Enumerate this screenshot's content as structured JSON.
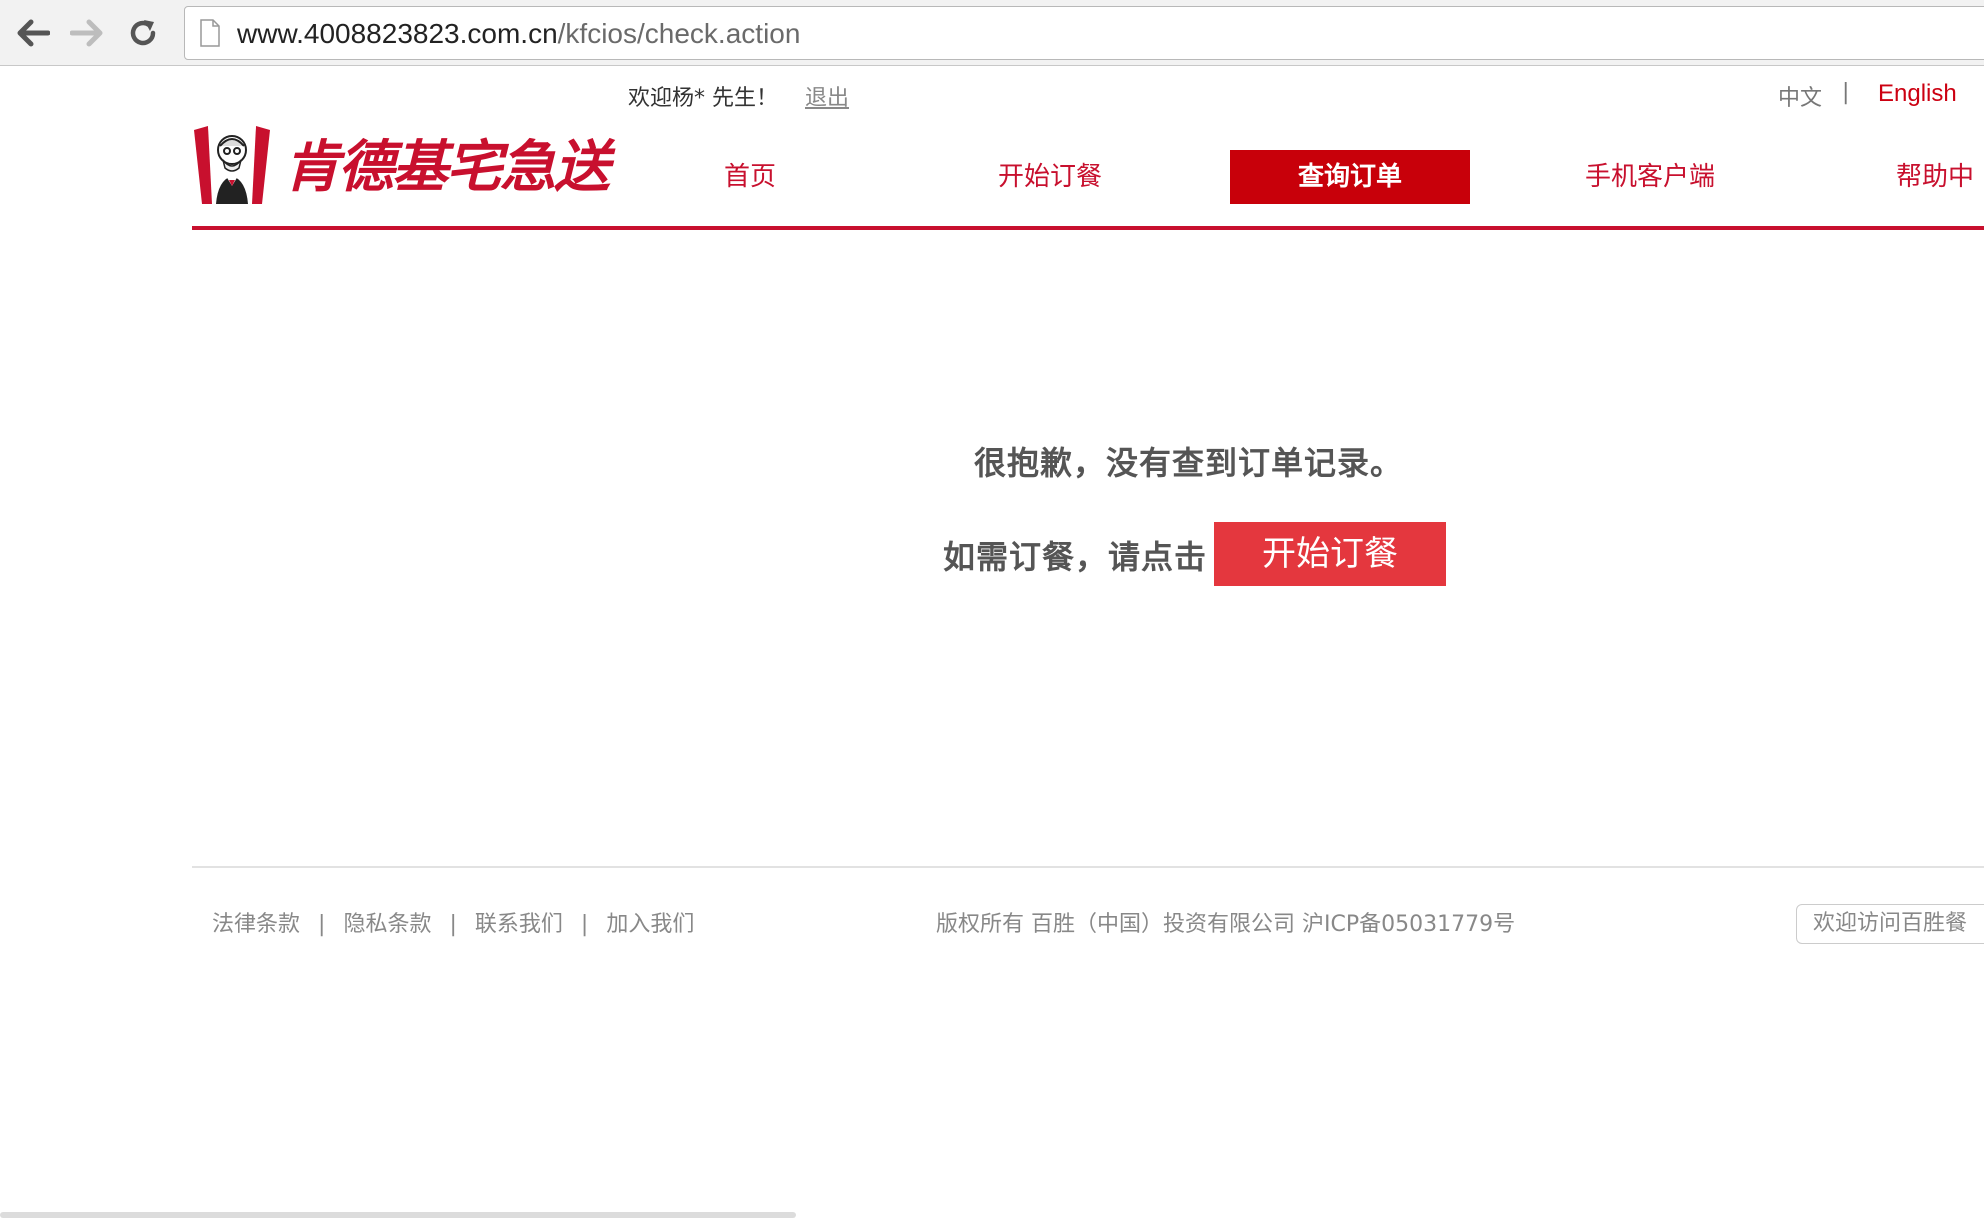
{
  "browser": {
    "url_host": "www.4008823823.com.cn",
    "url_path": "/kfcios/check.action"
  },
  "topbar": {
    "welcome": "欢迎杨* 先生！",
    "logout": "退出",
    "lang_zh": "中文",
    "lang_sep": "|",
    "lang_en": "English"
  },
  "logo": {
    "text": "肯德基宅急送"
  },
  "nav": {
    "items": [
      {
        "label": "首页"
      },
      {
        "label": "开始订餐"
      },
      {
        "label": "查询订单",
        "active": true
      },
      {
        "label": "手机客户端"
      },
      {
        "label": "帮助中"
      }
    ]
  },
  "content": {
    "message": "很抱歉，没有查到订单记录。",
    "prompt": "如需订餐，请点击",
    "button": "开始订餐"
  },
  "footer": {
    "links": [
      "法律条款",
      "隐私条款",
      "联系我们",
      "加入我们"
    ],
    "separator": "|",
    "copyright": "版权所有 百胜（中国）投资有限公司 沪ICP备05031779号",
    "visit": "欢迎访问百胜餐"
  },
  "colors": {
    "brand_red": "#c8102e",
    "active_nav_bg": "#c8000a",
    "button_red": "#e4373e"
  }
}
